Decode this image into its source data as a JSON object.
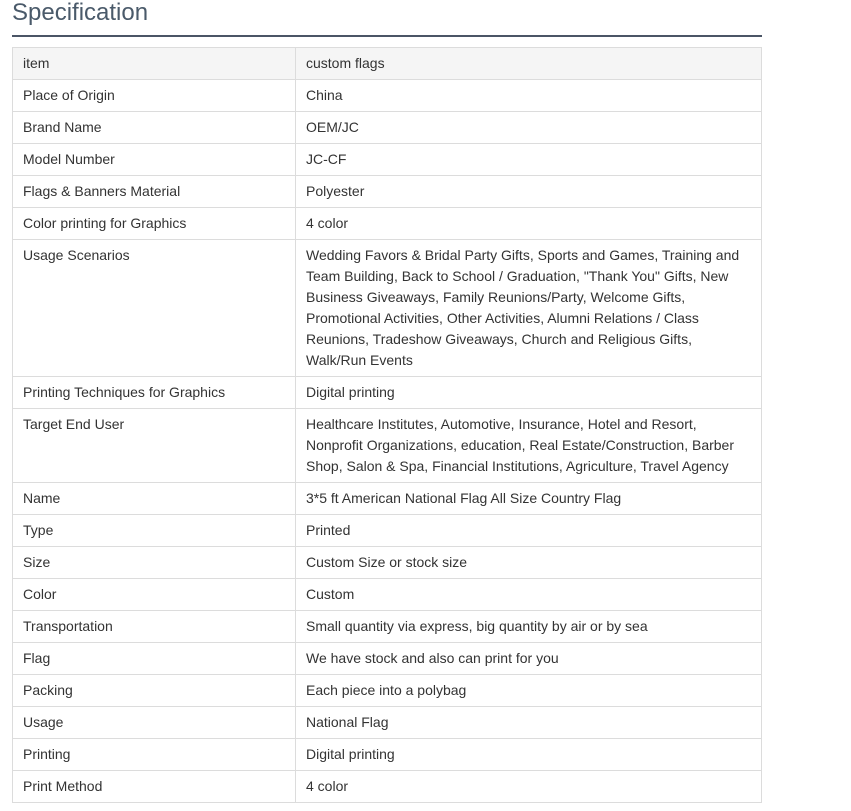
{
  "title": "Specification",
  "header": {
    "key": "item",
    "value": "custom flags"
  },
  "rows": [
    {
      "key": "Place of Origin",
      "value": "China"
    },
    {
      "key": "Brand Name",
      "value": "OEM/JC"
    },
    {
      "key": "Model Number",
      "value": "JC-CF"
    },
    {
      "key": "Flags & Banners Material",
      "value": "Polyester"
    },
    {
      "key": "Color printing for Graphics",
      "value": "4 color"
    },
    {
      "key": "Usage Scenarios",
      "value": "Wedding Favors & Bridal Party Gifts, Sports and Games, Training and Team Building, Back to School / Graduation, \"Thank You\" Gifts, New Business Giveaways, Family Reunions/Party, Welcome Gifts, Promotional Activities, Other Activities, Alumni Relations / Class Reunions, Tradeshow Giveaways, Church and Religious Gifts, Walk/Run Events"
    },
    {
      "key": "Printing Techniques for Graphics",
      "value": "Digital printing"
    },
    {
      "key": "Target End User",
      "value": "Healthcare Institutes, Automotive, Insurance, Hotel and Resort, Nonprofit Organizations, education, Real Estate/Construction, Barber Shop, Salon & Spa, Financial Institutions, Agriculture, Travel Agency"
    },
    {
      "key": "Name",
      "value": "3*5 ft American National Flag All Size Country Flag"
    },
    {
      "key": "Type",
      "value": "Printed"
    },
    {
      "key": "Size",
      "value": "Custom Size or stock size"
    },
    {
      "key": "Color",
      "value": "Custom"
    },
    {
      "key": "Transportation",
      "value": "Small quantity via express, big quantity by air or by sea"
    },
    {
      "key": "Flag",
      "value": "We have stock and also can print for you"
    },
    {
      "key": "Packing",
      "value": "Each piece into a polybag"
    },
    {
      "key": "Usage",
      "value": "National Flag"
    },
    {
      "key": "Printing",
      "value": "Digital printing"
    },
    {
      "key": "Print Method",
      "value": "4 color"
    }
  ]
}
